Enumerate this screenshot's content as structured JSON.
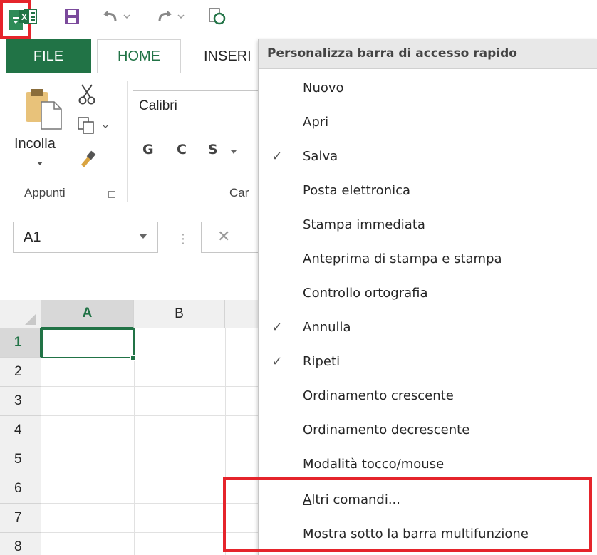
{
  "app": {
    "brand_color": "#217346",
    "highlight_color": "#e5242b"
  },
  "quick_access": {
    "icons": [
      "excel-icon",
      "save-icon",
      "undo-icon",
      "redo-icon",
      "refresh-icon",
      "customize-dropdown-icon"
    ]
  },
  "tabs": {
    "file": "FILE",
    "home": "HOME",
    "insert": "INSERI"
  },
  "ribbon": {
    "paste_label": "Incolla",
    "clipboard_group": "Appunti",
    "font_group": "Car",
    "font_name": "Calibri",
    "bold": "G",
    "italic": "C",
    "underline": "S"
  },
  "formula_bar": {
    "name_box": "A1",
    "cancel": "✕"
  },
  "grid": {
    "columns": [
      "A",
      "B"
    ],
    "rows": [
      "1",
      "2",
      "3",
      "4",
      "5",
      "6",
      "7",
      "8"
    ],
    "active_cell": "A1"
  },
  "menu": {
    "title": "Personalizza barra di accesso rapido",
    "items": [
      {
        "label": "Nuovo",
        "checked": false
      },
      {
        "label": "Apri",
        "checked": false
      },
      {
        "label": "Salva",
        "checked": true
      },
      {
        "label": "Posta elettronica",
        "checked": false
      },
      {
        "label": "Stampa immediata",
        "checked": false
      },
      {
        "label": "Anteprima di stampa e stampa",
        "checked": false
      },
      {
        "label": "Controllo ortografia",
        "checked": false
      },
      {
        "label": "Annulla",
        "checked": true
      },
      {
        "label": "Ripeti",
        "checked": true
      },
      {
        "label": "Ordinamento crescente",
        "checked": false
      },
      {
        "label": "Ordinamento decrescente",
        "checked": false
      },
      {
        "label": "Modalità tocco/mouse",
        "checked": false
      },
      {
        "label": "Altri comandi...",
        "checked": false
      },
      {
        "label": "Mostra sotto la barra multifunzione",
        "checked": false
      }
    ],
    "check_glyph": "✓"
  }
}
